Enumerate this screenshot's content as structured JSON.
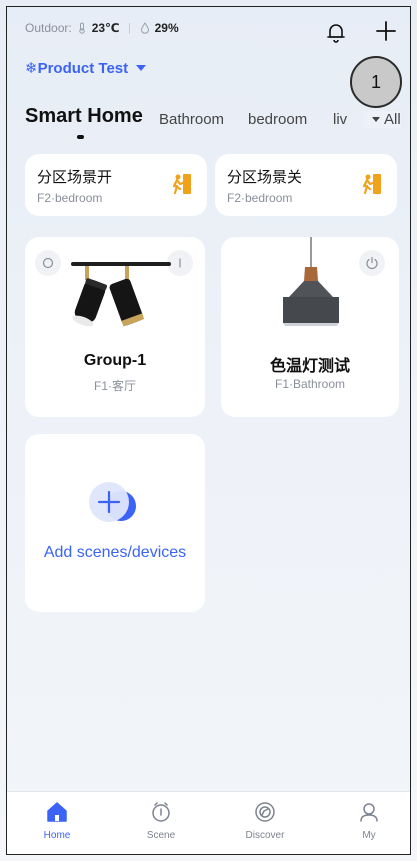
{
  "status": {
    "outdoor_label": "Outdoor:",
    "temperature": "23℃",
    "humidity": "29%"
  },
  "home": {
    "name": "❄Product Test"
  },
  "badge": {
    "number": "1"
  },
  "tabs": {
    "items": [
      "Smart Home",
      "Bathroom",
      "bedroom",
      "liv"
    ],
    "all_label": "All"
  },
  "scenes": [
    {
      "title": "分区场景开",
      "location": "F2·bedroom"
    },
    {
      "title": "分区场景关",
      "location": "F2·bedroom"
    }
  ],
  "devices": [
    {
      "name": "Group-1",
      "room": "F1·客厅"
    },
    {
      "name": "色温灯测试",
      "room": "F1·Bathroom"
    }
  ],
  "add_card": {
    "label": "Add scenes/devices"
  },
  "nav": {
    "items": [
      "Home",
      "Scene",
      "Discover",
      "My"
    ]
  },
  "colors": {
    "accent": "#3b63f5",
    "scene_icon": "#f0a31a"
  }
}
